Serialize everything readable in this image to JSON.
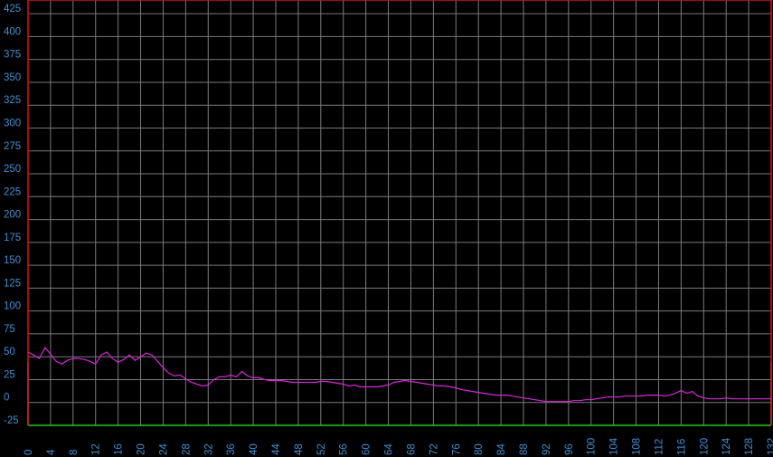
{
  "chart_data": {
    "type": "line",
    "title": "",
    "xlabel": "",
    "ylabel": "",
    "xlim": [
      0,
      132
    ],
    "ylim": [
      -25,
      440
    ],
    "x_ticks": [
      0,
      4,
      8,
      12,
      16,
      20,
      24,
      28,
      32,
      36,
      40,
      44,
      48,
      52,
      56,
      60,
      64,
      68,
      72,
      76,
      80,
      84,
      88,
      92,
      96,
      100,
      104,
      108,
      112,
      116,
      120,
      124,
      128,
      132
    ],
    "y_ticks": [
      -25,
      0,
      25,
      50,
      75,
      100,
      125,
      150,
      175,
      200,
      225,
      250,
      275,
      300,
      325,
      350,
      375,
      400,
      425
    ],
    "grid": true,
    "colors": {
      "series": "#e020e0",
      "grid": "#7a7a7a",
      "tick_label": "#3a8fd6",
      "upper_band": "#e01010",
      "lower_band": "#10d010",
      "background": "#000000"
    },
    "bands": {
      "upper": 440,
      "lower": -25
    },
    "series": [
      {
        "x": [
          0,
          1,
          2,
          3,
          4,
          5,
          6,
          7,
          8,
          9,
          10,
          11,
          12,
          13,
          14,
          15,
          16,
          17,
          18,
          19,
          20,
          21,
          22,
          23,
          24,
          25,
          26,
          27,
          28,
          29,
          30,
          31,
          32,
          33,
          34,
          35,
          36,
          37,
          38,
          39,
          40,
          41,
          42,
          43,
          44,
          45,
          46,
          47,
          48,
          49,
          50,
          51,
          52,
          53,
          54,
          55,
          56,
          57,
          58,
          59,
          60,
          61,
          62,
          63,
          64,
          65,
          66,
          67,
          68,
          69,
          70,
          71,
          72,
          73,
          74,
          75,
          76,
          77,
          78,
          79,
          80,
          81,
          82,
          83,
          84,
          85,
          86,
          87,
          88,
          89,
          90,
          91,
          92,
          93,
          94,
          95,
          96,
          97,
          98,
          99,
          100,
          101,
          102,
          103,
          104,
          105,
          106,
          107,
          108,
          109,
          110,
          111,
          112,
          113,
          114,
          115,
          116,
          117,
          118,
          119,
          120,
          121,
          122,
          123,
          124,
          125,
          126,
          127,
          128,
          129,
          130,
          131,
          132
        ],
        "values": [
          55,
          52,
          48,
          60,
          53,
          45,
          42,
          46,
          48,
          48,
          47,
          45,
          42,
          52,
          55,
          48,
          44,
          47,
          52,
          46,
          50,
          54,
          52,
          45,
          38,
          32,
          29,
          30,
          26,
          22,
          20,
          18,
          19,
          25,
          28,
          28,
          30,
          28,
          34,
          29,
          27,
          27,
          25,
          24,
          24,
          24,
          23,
          22,
          22,
          22,
          22,
          22,
          23,
          23,
          22,
          21,
          20,
          18,
          19,
          17,
          17,
          17,
          17,
          18,
          19,
          22,
          23,
          24,
          23,
          22,
          21,
          20,
          19,
          18,
          18,
          17,
          16,
          14,
          13,
          12,
          11,
          10,
          9,
          8,
          8,
          8,
          7,
          6,
          5,
          4,
          3,
          2,
          1,
          1,
          1,
          1,
          1,
          2,
          2,
          3,
          3,
          4,
          5,
          6,
          6,
          6,
          7,
          7,
          7,
          7,
          8,
          8,
          8,
          7,
          8,
          10,
          13,
          10,
          12,
          7,
          5,
          4,
          4,
          4,
          5,
          4,
          4,
          4,
          4,
          4,
          4,
          4,
          4
        ]
      }
    ]
  }
}
